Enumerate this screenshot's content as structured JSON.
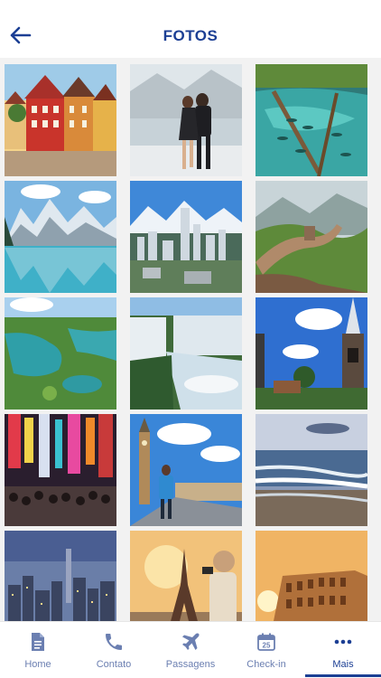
{
  "header": {
    "title": "FOTOS"
  },
  "photos": [
    "colorful-half-timbered-houses",
    "tango-dancers-waterfront",
    "turquoise-river-fish",
    "mountain-lake-reflection",
    "city-skyline-mountains",
    "great-wall-green-hills",
    "lagoon-aerial-view",
    "waterfalls-canyon",
    "church-steeple-blue-sky",
    "neon-street-crowd",
    "big-ben-traveler",
    "beach-waves-sunset",
    "city-skyline-dusk",
    "eiffel-tower-traveler",
    "colosseum-sunset"
  ],
  "tabs": [
    {
      "id": "home",
      "label": "Home",
      "icon": "document-icon"
    },
    {
      "id": "contato",
      "label": "Contato",
      "icon": "phone-icon"
    },
    {
      "id": "passagens",
      "label": "Passagens",
      "icon": "airplane-icon"
    },
    {
      "id": "checkin",
      "label": "Check-in",
      "icon": "calendar-icon",
      "badge": "25"
    },
    {
      "id": "mais",
      "label": "Mais",
      "icon": "more-icon",
      "active": true
    }
  ],
  "colors": {
    "primary": "#1c3f94",
    "tab_inactive": "#6b7fb1"
  }
}
